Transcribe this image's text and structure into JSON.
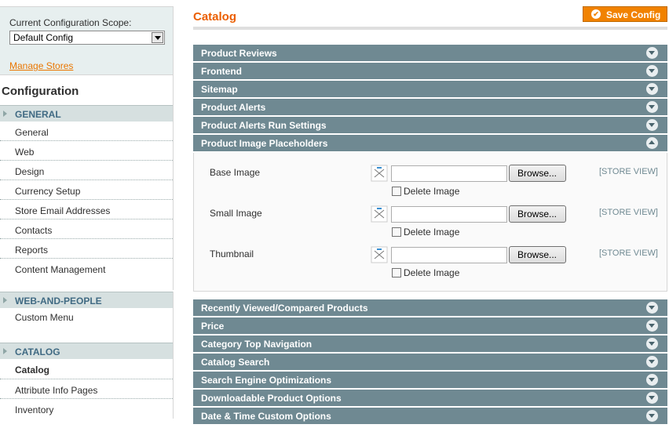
{
  "sidebar": {
    "scope_label": "Current Configuration Scope:",
    "scope_value": "Default Config",
    "manage_link": "Manage Stores",
    "config_title": "Configuration",
    "groups": [
      {
        "heading": "GENERAL",
        "items": [
          "General",
          "Web",
          "Design",
          "Currency Setup",
          "Store Email Addresses",
          "Contacts",
          "Reports",
          "Content Management"
        ]
      },
      {
        "heading": "WEB-AND-PEOPLE",
        "items": [
          "Custom Menu"
        ]
      },
      {
        "heading": "CATALOG",
        "items": [
          "Catalog",
          "Attribute Info Pages",
          "Inventory"
        ]
      }
    ]
  },
  "main": {
    "title": "Catalog",
    "save_label": "Save Config",
    "sections_top": [
      "Product Reviews",
      "Frontend",
      "Sitemap",
      "Product Alerts",
      "Product Alerts Run Settings"
    ],
    "open_section": "Product Image Placeholders",
    "fields": [
      {
        "label": "Base Image",
        "browse": "Browse...",
        "scope": "[STORE VIEW]",
        "delete": "Delete Image"
      },
      {
        "label": "Small Image",
        "browse": "Browse...",
        "scope": "[STORE VIEW]",
        "delete": "Delete Image"
      },
      {
        "label": "Thumbnail",
        "browse": "Browse...",
        "scope": "[STORE VIEW]",
        "delete": "Delete Image"
      }
    ],
    "sections_bottom": [
      "Recently Viewed/Compared Products",
      "Price",
      "Category Top Navigation",
      "Catalog Search",
      "Search Engine Optimizations",
      "Downloadable Product Options",
      "Date & Time Custom Options"
    ]
  },
  "colors": {
    "accent": "#eb5e00",
    "section_bar": "#6f8992",
    "sidebar_bg": "#e7efef"
  }
}
